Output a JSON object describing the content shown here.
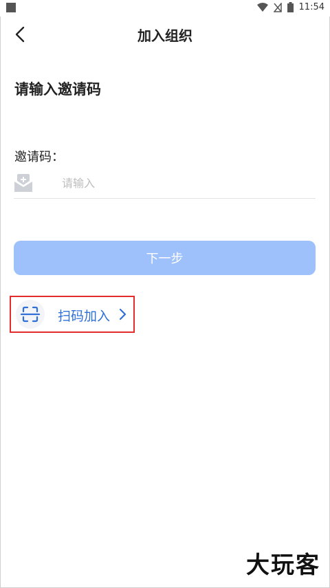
{
  "status_bar": {
    "time": "11:54"
  },
  "header": {
    "title": "加入组织"
  },
  "form": {
    "heading": "请输入邀请码",
    "code_label": "邀请码：",
    "code_value": "",
    "code_placeholder": "请输入",
    "next_label": "下一步"
  },
  "scan": {
    "label": "扫码加入"
  },
  "watermark": {
    "text": "大玩客"
  },
  "colors": {
    "accent": "#2e6fd8",
    "button_disabled": "#9ec1fb",
    "highlight_border": "#e32b2b"
  },
  "icons": [
    "back-chevron-icon",
    "mail-plus-icon",
    "scan-qr-icon",
    "chevron-right-icon",
    "wifi-icon",
    "signal-icon",
    "battery-icon"
  ]
}
